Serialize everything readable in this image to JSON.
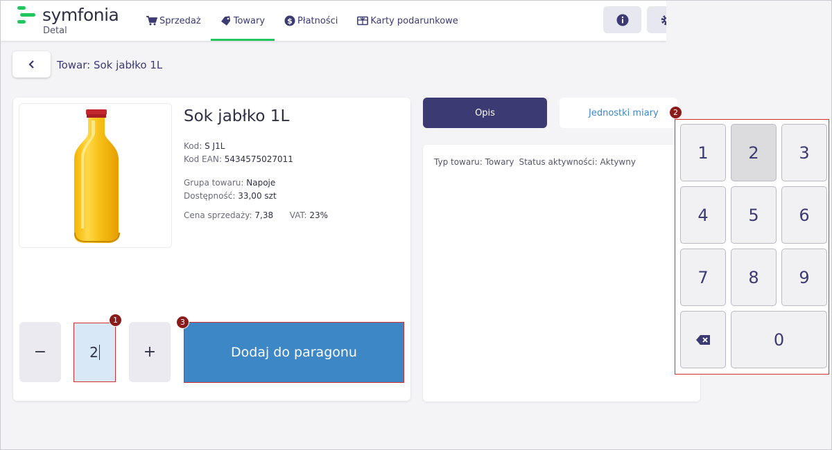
{
  "app": {
    "logo_name": "symfonia",
    "logo_sub": "Detal"
  },
  "nav": {
    "items": [
      {
        "label": "Sprzedaż",
        "icon": "cart-icon"
      },
      {
        "label": "Towary",
        "icon": "tag-icon",
        "active": true
      },
      {
        "label": "Płatności",
        "icon": "dollar-icon"
      },
      {
        "label": "Karty podarunkowe",
        "icon": "gift-card-icon"
      }
    ]
  },
  "header_buttons": [
    "info-icon",
    "gear-icon"
  ],
  "breadcrumb": {
    "title": "Towar: Sok jabłko 1L"
  },
  "product": {
    "name": "Sok jabłko 1L",
    "kod_label": "Kod:",
    "kod_value": "S J1L",
    "ean_label": "Kod EAN:",
    "ean_value": "5434575027011",
    "grupa_label": "Grupa towaru:",
    "grupa_value": "Napoje",
    "dostepnosc_label": "Dostępność:",
    "dostepnosc_value": "33,00 szt",
    "cena_label": "Cena sprzedaży:",
    "cena_value": "7,38",
    "vat_label": "VAT:",
    "vat_value": "23%"
  },
  "quantity": {
    "minus_label": "−",
    "value": "2",
    "plus_label": "+"
  },
  "add_button": {
    "label": "Dodaj do paragonu"
  },
  "tabs": [
    {
      "label": "Opis",
      "active": true
    },
    {
      "label": "Jednostki miary",
      "active": false
    }
  ],
  "description": {
    "typ_label": "Typ towaru:",
    "typ_value": "Towary",
    "status_label": "Status aktywności:",
    "status_value": "Aktywny"
  },
  "keypad": {
    "keys": [
      "1",
      "2",
      "3",
      "4",
      "5",
      "6",
      "7",
      "8",
      "9",
      "backspace",
      "0"
    ],
    "pressed": "2",
    "backspace_icon": "backspace-icon"
  },
  "markers": [
    "1",
    "2",
    "3"
  ],
  "colors": {
    "brand_green": "#22c55e",
    "primary_dark": "#3b3a72",
    "primary_blue": "#3d87c6",
    "annotation_red": "#d32f2f",
    "marker": "#8b1a1a"
  }
}
